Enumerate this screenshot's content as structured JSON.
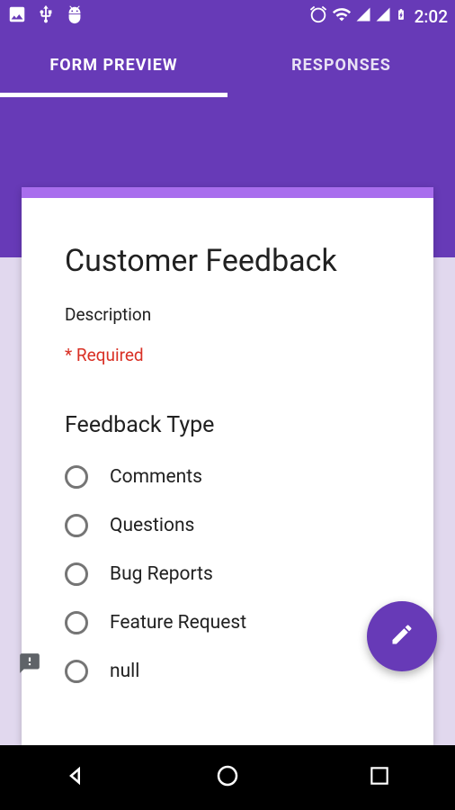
{
  "status": {
    "time": "2:02"
  },
  "tabs": {
    "form_preview": "FORM PREVIEW",
    "responses": "RESPONSES"
  },
  "form": {
    "title": "Customer Feedback",
    "description": "Description",
    "required_text": "* Required",
    "question_title": "Feedback Type",
    "options": [
      "Comments",
      "Questions",
      "Bug Reports",
      "Feature Request",
      "null"
    ]
  }
}
